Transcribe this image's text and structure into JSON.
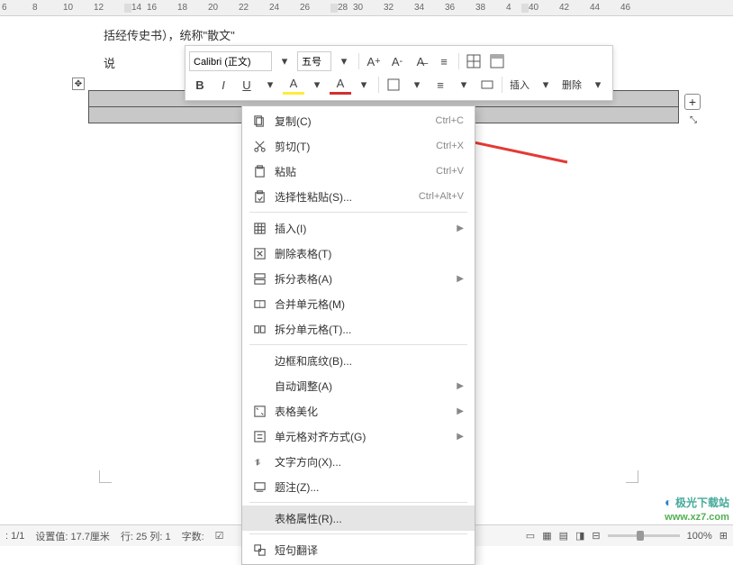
{
  "ruler": [
    "6",
    "",
    "8",
    "",
    "10",
    "",
    "12",
    "",
    "14",
    "",
    "16",
    "",
    "18",
    "",
    "20",
    "",
    "22",
    "",
    "24",
    "",
    "26",
    "",
    "28",
    "",
    "30",
    "",
    "32",
    "",
    "34",
    "",
    "36",
    "",
    "38",
    "",
    "4",
    "",
    "40",
    "",
    "42",
    "",
    "44",
    "",
    "46"
  ],
  "doc": {
    "line1": "括经传史书），统称\"散文\"",
    "line2": "说"
  },
  "mini": {
    "font": "Calibri (正文)",
    "size": "五号",
    "insert": "插入",
    "delete": "删除"
  },
  "menu": {
    "copy": "复制(C)",
    "copy_sc": "Ctrl+C",
    "cut": "剪切(T)",
    "cut_sc": "Ctrl+X",
    "paste": "粘贴",
    "paste_sc": "Ctrl+V",
    "paste_special": "选择性粘贴(S)...",
    "paste_special_sc": "Ctrl+Alt+V",
    "insert": "插入(I)",
    "delete_table": "删除表格(T)",
    "split_table": "拆分表格(A)",
    "merge_cells": "合并单元格(M)",
    "split_cells": "拆分单元格(T)...",
    "border": "边框和底纹(B)...",
    "autofit": "自动调整(A)",
    "beautify": "表格美化",
    "align": "单元格对齐方式(G)",
    "text_dir": "文字方向(X)...",
    "caption": "题注(Z)...",
    "props": "表格属性(R)...",
    "translate": "短句翻译"
  },
  "status": {
    "page": ": 1/1",
    "setval": "设置值: 17.7厘米",
    "rowcol": "行: 25  列: 1",
    "wordcount": "字数:",
    "zoom": "100%"
  },
  "watermark": {
    "title": "极光下载站",
    "url": "www.xz7.com"
  }
}
